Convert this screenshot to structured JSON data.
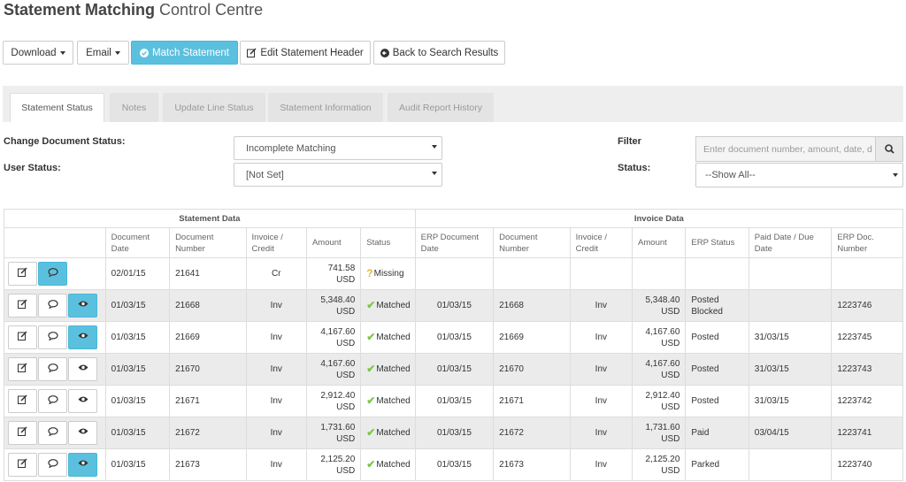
{
  "page": {
    "title_bold": "Statement Matching",
    "title_rest": "Control Centre"
  },
  "toolbar": {
    "download": "Download",
    "email": "Email",
    "match": "Match Statement",
    "edit_header": "Edit Statement Header",
    "back": "Back to Search Results"
  },
  "tabs": [
    "Statement Status",
    "Notes",
    "Update Line Status",
    "Statement Information",
    "Audit Report History"
  ],
  "form": {
    "change_doc_status_label": "Change Document Status:",
    "change_doc_status_value": "Incomplete Matching",
    "user_status_label": "User Status:",
    "user_status_value": "[Not Set]",
    "filter_label": "Filter",
    "filter_placeholder": "Enter document number, amount, date, d",
    "status_label": "Status:",
    "status_value": "--Show All--"
  },
  "table": {
    "group_statement": "Statement Data",
    "group_invoice": "Invoice Data",
    "headers": [
      "Document Date",
      "Document Number",
      "Invoice / Credit",
      "Amount",
      "Status",
      "ERP Document Date",
      "Document Number",
      "Invoice / Credit",
      "Amount",
      "ERP Status",
      "Paid Date / Due Date",
      "ERP Doc. Number"
    ],
    "rows": [
      {
        "doc_date": "02/01/15",
        "doc_number": "21641",
        "inv_credit": "Cr",
        "amount": "741.58 USD",
        "status": "Missing",
        "erp_date": "",
        "inv_doc_number": "",
        "inv_inv_credit": "",
        "inv_amount": "",
        "erp_status": "",
        "paid_date": "",
        "erp_doc": ""
      },
      {
        "doc_date": "01/03/15",
        "doc_number": "21668",
        "inv_credit": "Inv",
        "amount": "5,348.40 USD",
        "status": "Matched",
        "erp_date": "01/03/15",
        "inv_doc_number": "21668",
        "inv_inv_credit": "Inv",
        "inv_amount": "5,348.40 USD",
        "erp_status": "Posted Blocked",
        "paid_date": "",
        "erp_doc": "1223746"
      },
      {
        "doc_date": "01/03/15",
        "doc_number": "21669",
        "inv_credit": "Inv",
        "amount": "4,167.60 USD",
        "status": "Matched",
        "erp_date": "01/03/15",
        "inv_doc_number": "21669",
        "inv_inv_credit": "Inv",
        "inv_amount": "4,167.60 USD",
        "erp_status": "Posted",
        "paid_date": "31/03/15",
        "erp_doc": "1223745"
      },
      {
        "doc_date": "01/03/15",
        "doc_number": "21670",
        "inv_credit": "Inv",
        "amount": "4,167.60 USD",
        "status": "Matched",
        "erp_date": "01/03/15",
        "inv_doc_number": "21670",
        "inv_inv_credit": "Inv",
        "inv_amount": "4,167.60 USD",
        "erp_status": "Posted",
        "paid_date": "31/03/15",
        "erp_doc": "1223743"
      },
      {
        "doc_date": "01/03/15",
        "doc_number": "21671",
        "inv_credit": "Inv",
        "amount": "2,912.40 USD",
        "status": "Matched",
        "erp_date": "01/03/15",
        "inv_doc_number": "21671",
        "inv_inv_credit": "Inv",
        "inv_amount": "2,912.40 USD",
        "erp_status": "Posted",
        "paid_date": "31/03/15",
        "erp_doc": "1223742"
      },
      {
        "doc_date": "01/03/15",
        "doc_number": "21672",
        "inv_credit": "Inv",
        "amount": "1,731.60 USD",
        "status": "Matched",
        "erp_date": "01/03/15",
        "inv_doc_number": "21672",
        "inv_inv_credit": "Inv",
        "inv_amount": "1,731.60 USD",
        "erp_status": "Paid",
        "paid_date": "03/04/15",
        "erp_doc": "1223741"
      },
      {
        "doc_date": "01/03/15",
        "doc_number": "21673",
        "inv_credit": "Inv",
        "amount": "2,125.20 USD",
        "status": "Matched",
        "erp_date": "01/03/15",
        "inv_doc_number": "21673",
        "inv_inv_credit": "Inv",
        "inv_amount": "2,125.20 USD",
        "erp_status": "Parked",
        "paid_date": "",
        "erp_doc": "1223740"
      }
    ]
  },
  "icons": {
    "edit": "edit-icon",
    "comment": "comment-icon",
    "view": "eye-icon",
    "search": "search-icon",
    "check": "check-icon",
    "question": "question-icon"
  },
  "colors": {
    "info": "#5bc0de",
    "matched": "#7cc64a",
    "missing": "#e7b53a"
  }
}
